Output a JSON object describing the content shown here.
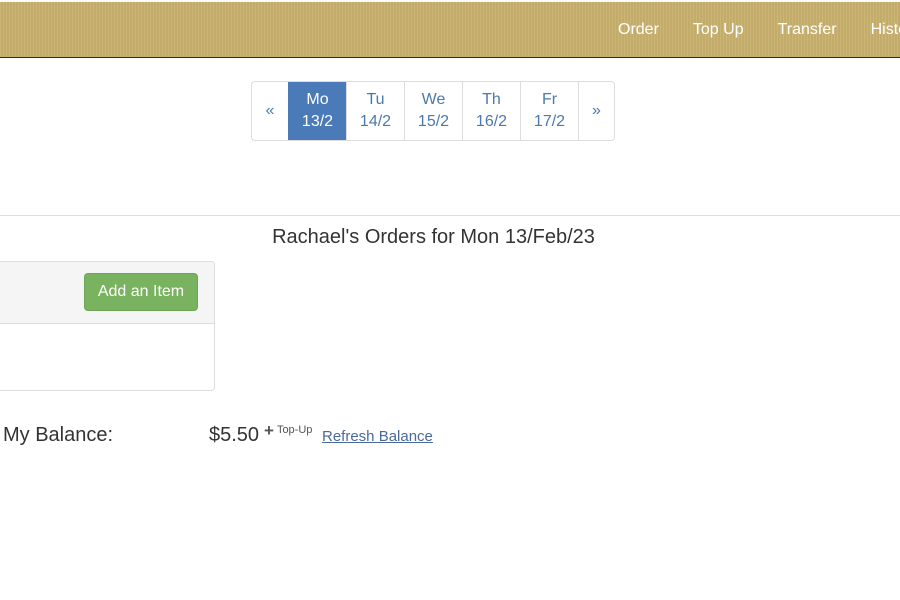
{
  "navbar": {
    "links": [
      "Order",
      "Top Up",
      "Transfer",
      "Histo"
    ],
    "bg_color": "#c9b26e"
  },
  "pager": {
    "prev_label": "«",
    "next_label": "»",
    "days": [
      {
        "day": "Mo",
        "date": "13/2",
        "active": true
      },
      {
        "day": "Tu",
        "date": "14/2",
        "active": false
      },
      {
        "day": "We",
        "date": "15/2",
        "active": false
      },
      {
        "day": "Th",
        "date": "16/2",
        "active": false
      },
      {
        "day": "Fr",
        "date": "17/2",
        "active": false
      }
    ],
    "active_color": "#4a7ab8"
  },
  "orders": {
    "title": "Rachael's Orders for Mon 13/Feb/23",
    "add_button_label": "Add an Item",
    "add_button_color": "#79b35f"
  },
  "balance": {
    "label": "My Balance:",
    "amount": "$5.50",
    "plus_icon": "+",
    "topup_label": "Top-Up",
    "refresh_label": "Refresh Balance"
  }
}
